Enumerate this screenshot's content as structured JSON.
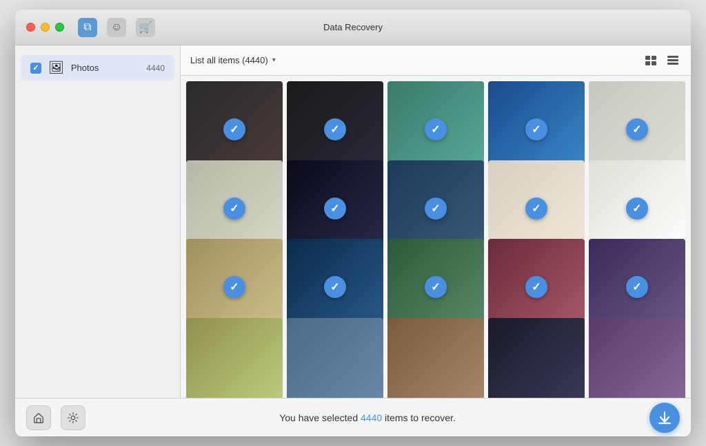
{
  "window": {
    "title": "Data Recovery"
  },
  "titlebar": {
    "traffic_lights": [
      "close",
      "minimize",
      "maximize"
    ],
    "icons": [
      {
        "name": "copy-icon",
        "label": "⧉",
        "active": true
      },
      {
        "name": "face-icon",
        "label": "☺",
        "active": false
      },
      {
        "name": "cart-icon",
        "label": "🛒",
        "active": false
      }
    ]
  },
  "sidebar": {
    "items": [
      {
        "id": "photos",
        "label": "Photos",
        "count": "4440",
        "checked": true
      }
    ]
  },
  "toolbar": {
    "dropdown_label": "List all items (4440)",
    "dropdown_arrow": "▾",
    "view_grid_icon": "⊞",
    "view_list_icon": "≡"
  },
  "photos": [
    {
      "id": 1,
      "bg": "#2a2a2a",
      "checked": true,
      "text": ""
    },
    {
      "id": 2,
      "bg": "#1a1a1a",
      "checked": true,
      "text": ""
    },
    {
      "id": 3,
      "bg": "#4a9a8a",
      "checked": true,
      "text": ""
    },
    {
      "id": 4,
      "bg": "#2266aa",
      "checked": true,
      "text": ""
    },
    {
      "id": 5,
      "bg": "#d0d0c8",
      "checked": true,
      "text": ""
    },
    {
      "id": 6,
      "bg": "#c8c8b8",
      "checked": true,
      "text": ""
    },
    {
      "id": 7,
      "bg": "#1a1a2a",
      "checked": true,
      "text": ""
    },
    {
      "id": 8,
      "bg": "#2a4a6a",
      "checked": true,
      "text": ""
    },
    {
      "id": 9,
      "bg": "#e8e0d0",
      "checked": true,
      "text": ""
    },
    {
      "id": 10,
      "bg": "#f0f0e8",
      "checked": true,
      "text": ""
    },
    {
      "id": 11,
      "bg": "#c8b890",
      "checked": true,
      "text": ""
    },
    {
      "id": 12,
      "bg": "#1a3a5a",
      "checked": true,
      "text": ""
    },
    {
      "id": 13,
      "bg": "#3a6a4a",
      "checked": true,
      "text": ""
    },
    {
      "id": 14,
      "bg": "#8a2a3a",
      "checked": true,
      "text": ""
    },
    {
      "id": 15,
      "bg": "#4a3a6a",
      "checked": true,
      "text": ""
    },
    {
      "id": 16,
      "bg": "#d0c8a0",
      "checked": false,
      "text": ""
    },
    {
      "id": 17,
      "bg": "#4a6a8a",
      "checked": false,
      "text": ""
    },
    {
      "id": 18,
      "bg": "#8a6a4a",
      "checked": false,
      "text": ""
    },
    {
      "id": 19,
      "bg": "#2a2a3a",
      "checked": false,
      "text": ""
    },
    {
      "id": 20,
      "bg": "#6a4a7a",
      "checked": false,
      "text": ""
    }
  ],
  "bottombar": {
    "home_icon": "⌂",
    "settings_icon": "⚙",
    "status_prefix": "You have selected ",
    "status_count": "4440",
    "status_suffix": " items to recover.",
    "recover_icon": "↓"
  }
}
